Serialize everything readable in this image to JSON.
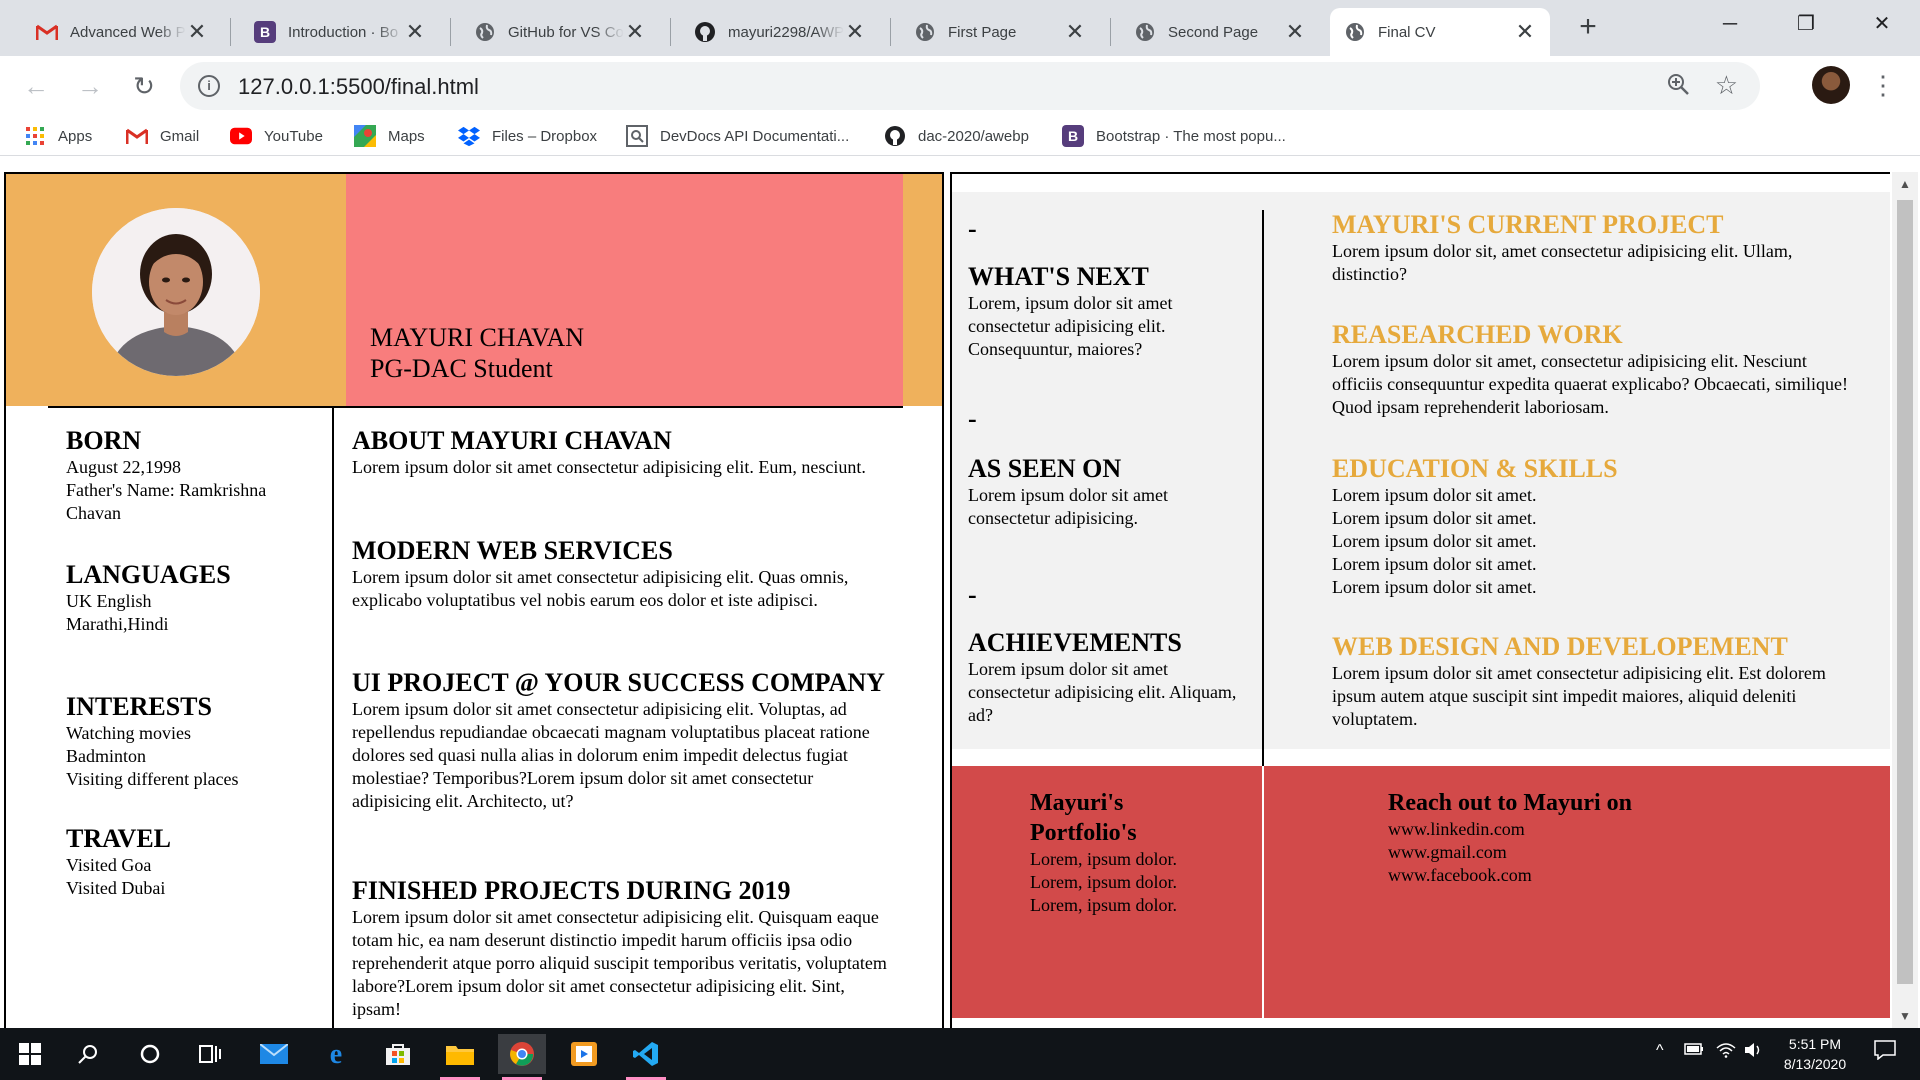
{
  "browser": {
    "tabs": [
      {
        "title": "Advanced Web P",
        "icon": "gmail-icon"
      },
      {
        "title": "Introduction · Bo",
        "icon": "bootstrap-icon"
      },
      {
        "title": "GitHub for VS Co",
        "icon": "globe-icon"
      },
      {
        "title": "mayuri2298/AWP",
        "icon": "github-icon"
      },
      {
        "title": "First Page",
        "icon": "globe-icon"
      },
      {
        "title": "Second Page",
        "icon": "globe-icon"
      },
      {
        "title": "Final CV",
        "icon": "globe-icon",
        "active": true
      }
    ],
    "url": "127.0.0.1:5500/final.html",
    "bookmarks": [
      {
        "label": "Apps",
        "icon": "apps-grid-icon"
      },
      {
        "label": "Gmail",
        "icon": "gmail-icon"
      },
      {
        "label": "YouTube",
        "icon": "youtube-icon"
      },
      {
        "label": "Maps",
        "icon": "maps-icon"
      },
      {
        "label": "Files – Dropbox",
        "icon": "dropbox-icon"
      },
      {
        "label": "DevDocs API Documentati...",
        "icon": "devdocs-icon"
      },
      {
        "label": "dac-2020/awebp",
        "icon": "github-icon"
      },
      {
        "label": "Bootstrap · The most popu...",
        "icon": "bootstrap-icon"
      }
    ]
  },
  "cv": {
    "header": {
      "name": "MAYURI CHAVAN",
      "role": "PG-DAC Student"
    },
    "born": {
      "heading": "BORN",
      "lines": [
        "August 22,1998",
        "Father's Name: Ramkrishna Chavan"
      ]
    },
    "languages": {
      "heading": "LANGUAGES",
      "lines": [
        "UK English",
        "Marathi,Hindi"
      ]
    },
    "interests": {
      "heading": "INTERESTS",
      "lines": [
        "Watching movies",
        "Badminton",
        "Visiting different places"
      ]
    },
    "travel": {
      "heading": "TRAVEL",
      "lines": [
        "Visited Goa",
        "Visited Dubai"
      ]
    },
    "about": {
      "heading": "ABOUT MAYURI CHAVAN",
      "text": "Lorem ipsum dolor sit amet consectetur adipisicing elit. Eum, nesciunt."
    },
    "modern": {
      "heading": "MODERN WEB SERVICES",
      "text": "Lorem ipsum dolor sit amet consectetur adipisicing elit. Quas omnis, explicabo voluptatibus vel nobis earum eos dolor et iste adipisci."
    },
    "ui_project": {
      "heading": "UI PROJECT @ YOUR SUCCESS COMPANY",
      "text": "Lorem ipsum dolor sit amet consectetur adipisicing elit. Voluptas, ad repellendus repudiandae obcaecati magnam voluptatibus placeat ratione dolores sed quasi nulla alias in dolorum enim impedit delectus fugiat molestiae? Temporibus?Lorem ipsum dolor sit amet consectetur adipisicing elit. Architecto, ut?"
    },
    "finished": {
      "heading": "FINISHED PROJECTS DURING 2019",
      "text": "Lorem ipsum dolor sit amet consectetur adipisicing elit. Quisquam eaque totam hic, ea nam deserunt distinctio impedit harum officiis ipsa odio reprehenderit atque porro aliquid suscipit temporibus veritatis, voluptatem labore?Lorem ipsum dolor sit amet consectetur adipisicing elit. Sint, ipsam!"
    },
    "dash": "-",
    "whats_next": {
      "heading": "WHAT'S NEXT",
      "text": "Lorem, ipsum dolor sit amet consectetur adipisicing elit. Consequuntur, maiores?"
    },
    "as_seen_on": {
      "heading": "AS SEEN ON",
      "text": "Lorem ipsum dolor sit amet consectetur adipisicing."
    },
    "achievements": {
      "heading": "ACHIEVEMENTS",
      "text": "Lorem ipsum dolor sit amet consectetur adipisicing elit. Aliquam, ad?"
    },
    "current_project": {
      "heading": "MAYURI'S CURRENT PROJECT",
      "text": "Lorem ipsum dolor sit, amet consectetur adipisicing elit. Ullam, distinctio?"
    },
    "researched": {
      "heading": "REASEARCHED WORK",
      "text": "Lorem ipsum dolor sit amet, consectetur adipisicing elit. Nesciunt officiis consequuntur expedita quaerat explicabo? Obcaecati, similique! Quod ipsam reprehenderit laboriosam."
    },
    "education": {
      "heading": "EDUCATION & SKILLS",
      "lines": [
        "Lorem ipsum dolor sit amet.",
        "Lorem ipsum dolor sit amet.",
        "Lorem ipsum dolor sit amet.",
        "Lorem ipsum dolor sit amet.",
        "Lorem ipsum dolor sit amet."
      ]
    },
    "web_design": {
      "heading": "WEB DESIGN AND DEVELOPEMENT",
      "text": "Lorem ipsum dolor sit amet consectetur adipisicing elit. Est dolorem ipsum autem atque suscipit sint impedit maiores, aliquid deleniti voluptatem."
    },
    "portfolio": {
      "heading": "Mayuri's Portfolio's",
      "lines": [
        "Lorem, ipsum dolor.",
        "Lorem, ipsum dolor.",
        "Lorem, ipsum dolor."
      ]
    },
    "reach": {
      "heading": "Reach out to Mayuri on",
      "lines": [
        "www.linkedin.com",
        "www.gmail.com",
        "www.facebook.com"
      ]
    }
  },
  "taskbar": {
    "time": "5:51 PM",
    "date": "8/13/2020"
  },
  "colors": {
    "orange": "#efb15c",
    "pink": "#f87d7d",
    "gold": "#e6a93c",
    "red": "#d24a4a",
    "panel_gray": "#f2f2f2"
  }
}
